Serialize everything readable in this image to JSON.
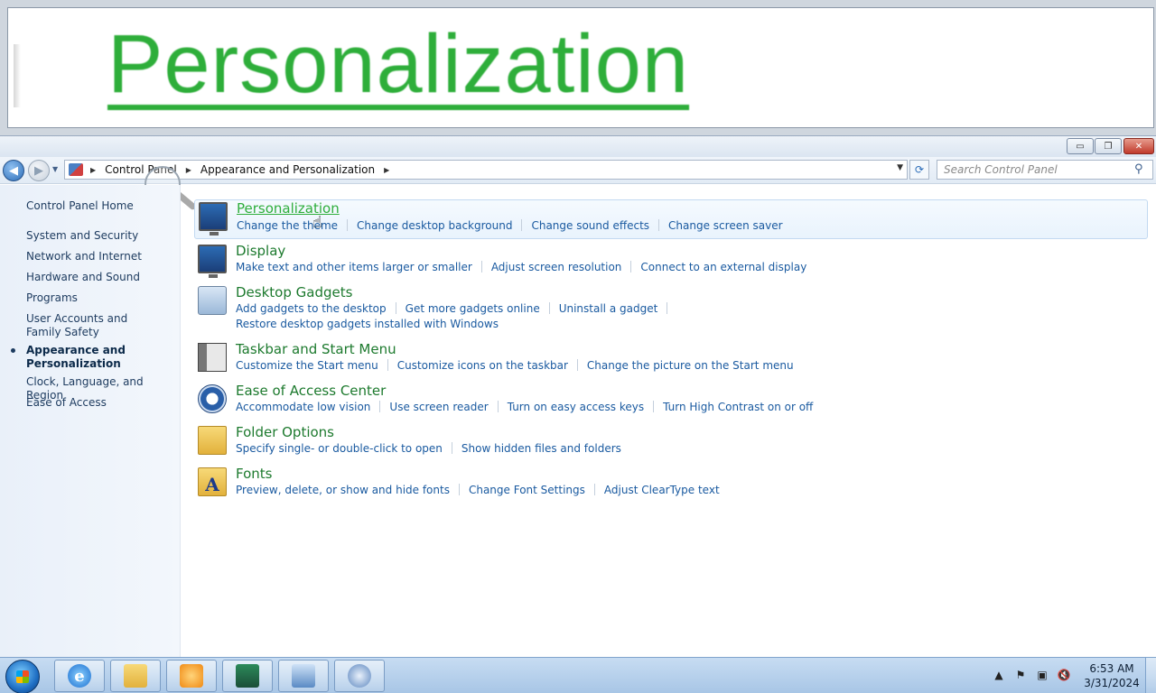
{
  "magnifier": {
    "text": "Personalization"
  },
  "window": {
    "caption": {
      "minimize": "▭",
      "maximize": "❐",
      "close": "✕"
    }
  },
  "nav": {
    "breadcrumb": [
      "Control Panel",
      "Appearance and Personalization"
    ],
    "search_placeholder": "Search Control Panel"
  },
  "sidebar": {
    "items": [
      {
        "label": "Control Panel Home"
      },
      {
        "label": "System and Security"
      },
      {
        "label": "Network and Internet"
      },
      {
        "label": "Hardware and Sound"
      },
      {
        "label": "Programs"
      },
      {
        "label": "User Accounts and Family Safety"
      },
      {
        "label": "Appearance and Personalization",
        "active": true
      },
      {
        "label": "Clock, Language, and Region"
      },
      {
        "label": "Ease of Access"
      }
    ]
  },
  "categories": [
    {
      "title": "Personalization",
      "icon": "personalization-icon",
      "links": [
        "Change the theme",
        "Change desktop background",
        "Change sound effects",
        "Change screen saver"
      ]
    },
    {
      "title": "Display",
      "icon": "display-icon",
      "links": [
        "Make text and other items larger or smaller",
        "Adjust screen resolution",
        "Connect to an external display"
      ]
    },
    {
      "title": "Desktop Gadgets",
      "icon": "gadgets-icon",
      "links": [
        "Add gadgets to the desktop",
        "Get more gadgets online",
        "Uninstall a gadget",
        "Restore desktop gadgets installed with Windows"
      ]
    },
    {
      "title": "Taskbar and Start Menu",
      "icon": "taskbar-icon",
      "links": [
        "Customize the Start menu",
        "Customize icons on the taskbar",
        "Change the picture on the Start menu"
      ]
    },
    {
      "title": "Ease of Access Center",
      "icon": "ease-of-access-icon",
      "links": [
        "Accommodate low vision",
        "Use screen reader",
        "Turn on easy access keys",
        "Turn High Contrast on or off"
      ]
    },
    {
      "title": "Folder Options",
      "icon": "folder-options-icon",
      "links": [
        "Specify single- or double-click to open",
        "Show hidden files and folders"
      ]
    },
    {
      "title": "Fonts",
      "icon": "fonts-icon",
      "links": [
        "Preview, delete, or show and hide fonts",
        "Change Font Settings",
        "Adjust ClearType text"
      ]
    }
  ],
  "taskbar": {
    "ie_glyph": "e",
    "fonts_glyph": "A",
    "clock": {
      "time": "6:53 AM",
      "date": "3/31/2024"
    }
  },
  "colors": {
    "category_title": "#1d7a2e",
    "link": "#1a5aa0",
    "hover_title": "#2fae3c"
  }
}
